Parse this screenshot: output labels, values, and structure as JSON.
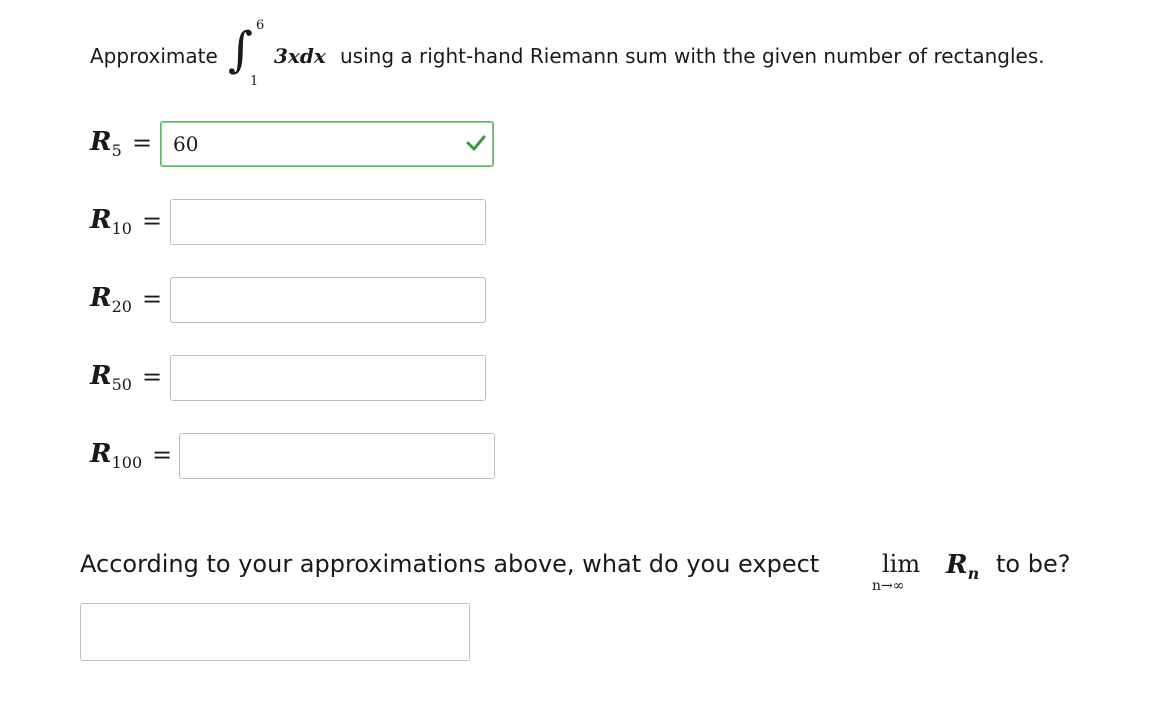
{
  "prompt": {
    "before": "Approximate",
    "integral_upper": "6",
    "integral_lower": "1",
    "integrand": "3xdx",
    "after": "using a right-hand Riemann sum with the given number of rectangles."
  },
  "rows": [
    {
      "label": "R",
      "sub": "5",
      "eq": "=",
      "value": "60",
      "status": "correct"
    },
    {
      "label": "R",
      "sub": "10",
      "eq": "=",
      "value": ""
    },
    {
      "label": "R",
      "sub": "20",
      "eq": "=",
      "value": ""
    },
    {
      "label": "R",
      "sub": "50",
      "eq": "=",
      "value": ""
    },
    {
      "label": "R",
      "sub": "100",
      "eq": "=",
      "value": ""
    }
  ],
  "question": {
    "before": "According to your approximations above, what do you expect",
    "lim": "lim",
    "lim_sub": "n→∞",
    "rn": "R",
    "rn_sub": "n",
    "after": "to be?"
  },
  "answer": {
    "value": ""
  },
  "colors": {
    "correct_border": "#5cb85c",
    "check_mark": "#3c9a3c",
    "input_border": "#bdbdbd"
  }
}
